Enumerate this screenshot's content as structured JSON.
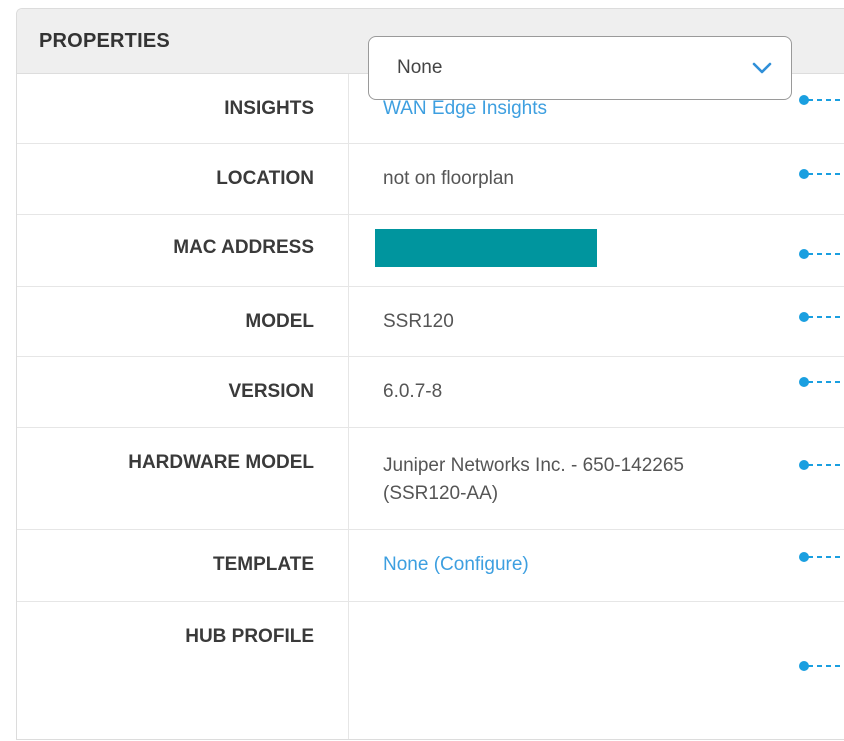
{
  "panel": {
    "title": "PROPERTIES"
  },
  "rows": [
    {
      "label": "INSIGHTS",
      "value": "WAN Edge Insights",
      "is_link": true
    },
    {
      "label": "LOCATION",
      "value": "not on floorplan",
      "is_link": false
    },
    {
      "label": "MAC ADDRESS",
      "value": "",
      "redacted": true
    },
    {
      "label": "MODEL",
      "value": "SSR120",
      "is_link": false
    },
    {
      "label": "VERSION",
      "value": "6.0.7-8",
      "is_link": false
    },
    {
      "label": "HARDWARE MODEL",
      "value_line1": "Juniper Networks Inc. - 650-142265",
      "value_line2": "(SSR120-AA)",
      "is_link": false
    },
    {
      "label": "TEMPLATE",
      "value": "None (Configure)",
      "is_link": true
    },
    {
      "label": "HUB PROFILE",
      "select_value": "None"
    }
  ],
  "colors": {
    "link": "#3d9fe0",
    "redaction": "#00959e",
    "connector": "#1a9fe0"
  },
  "icons": {
    "connector": "connector-dot-icon",
    "dropdown": "chevron-down-icon"
  }
}
